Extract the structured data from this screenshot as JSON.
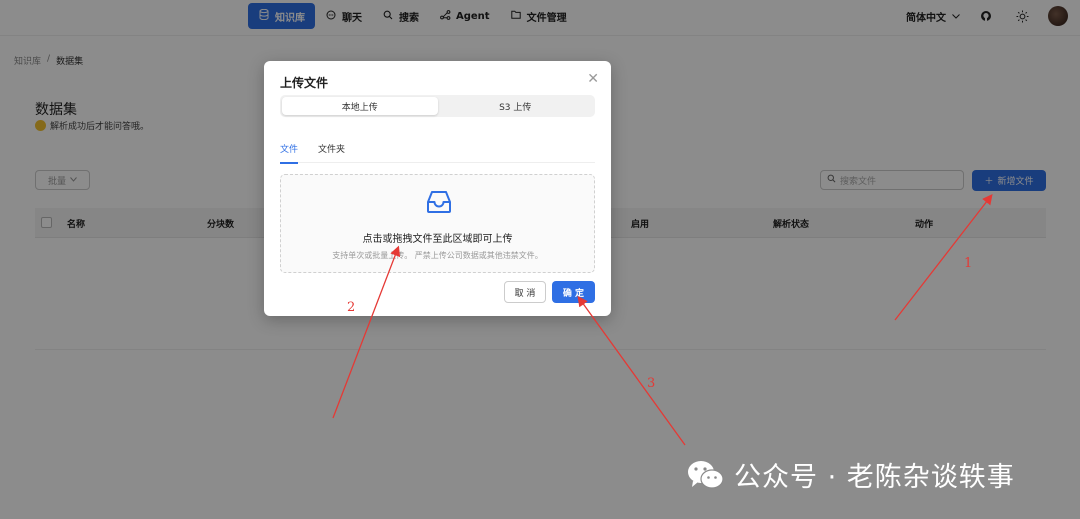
{
  "nav": {
    "items": [
      {
        "label": "知识库",
        "icon": "database-icon",
        "active": true
      },
      {
        "label": "聊天",
        "icon": "chat-icon"
      },
      {
        "label": "搜索",
        "icon": "search-icon"
      },
      {
        "label": "Agent",
        "icon": "agent-icon"
      },
      {
        "label": "文件管理",
        "icon": "folder-icon"
      }
    ],
    "language": "简体中文"
  },
  "breadcrumb": {
    "root": "知识库",
    "separator": "/",
    "current": "数据集"
  },
  "page": {
    "title": "数据集",
    "tip": "解析成功后才能问答哦。",
    "batch_label": "批量",
    "search_placeholder": "搜索文件",
    "new_file_label": "新增文件"
  },
  "table": {
    "columns": [
      "名称",
      "分块数",
      "启用",
      "解析状态",
      "动作"
    ]
  },
  "modal": {
    "title": "上传文件",
    "segments": [
      "本地上传",
      "S3 上传"
    ],
    "tabs": [
      "文件",
      "文件夹"
    ],
    "dropzone_main": "点击或拖拽文件至此区域即可上传",
    "dropzone_sub": "支持单次或批量上传。 严禁上传公司数据或其他违禁文件。",
    "cancel_label": "取 消",
    "ok_label": "确 定"
  },
  "annotations": [
    "1",
    "2",
    "3"
  ],
  "watermark": "公众号 · 老陈杂谈轶事",
  "colors": {
    "accent": "#2f6fe4",
    "annotation": "#e53935"
  }
}
